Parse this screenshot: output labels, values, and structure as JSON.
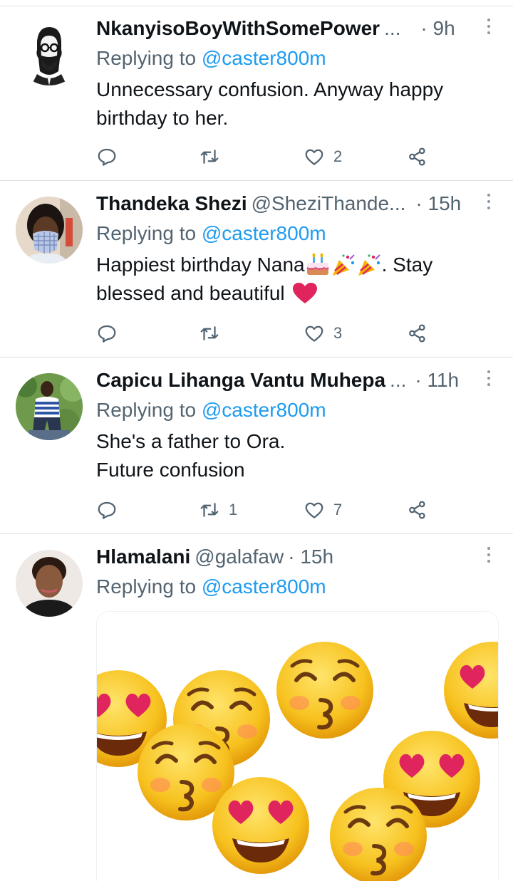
{
  "replies": [
    {
      "name": "NkanyisoBoyWithSomePower",
      "handle": "",
      "ellipsis": "...",
      "time": "· 9h",
      "replying_prefix": "Replying to ",
      "replying_handle": "@caster800m",
      "text_lines": [
        "Unnecessary confusion. Anyway happy",
        "birthday to her."
      ],
      "reply_count": "",
      "retweet_count": "",
      "like_count": "2"
    },
    {
      "name": "Thandeka Shezi",
      "handle": "@SheziThande...",
      "ellipsis": "",
      "time": "· 15h",
      "replying_prefix": "Replying to ",
      "replying_handle": "@caster800m",
      "text_line1": "Happiest birthday Nana",
      "text_line1_suffix": ". Stay",
      "text_line2": "blessed and beautiful",
      "reply_count": "",
      "retweet_count": "",
      "like_count": "3"
    },
    {
      "name": "Capicu Lihanga Vantu Muhepa",
      "handle": "",
      "ellipsis": "...",
      "time": "· 11h",
      "replying_prefix": "Replying to ",
      "replying_handle": "@caster800m",
      "text_lines": [
        "She's a father to Ora.",
        "Future confusion"
      ],
      "reply_count": "",
      "retweet_count": "1",
      "like_count": "7"
    },
    {
      "name": "Hlamalani",
      "handle": "@galafaw",
      "ellipsis": "",
      "time": "· 15h",
      "replying_prefix": "Replying to ",
      "replying_handle": "@caster800m",
      "media": "kissing and heart-eyes emoji image"
    }
  ],
  "icons": {
    "reply": "reply-icon",
    "retweet": "retweet-icon",
    "like": "heart-icon",
    "share": "share-icon",
    "more": "more-icon"
  },
  "colors": {
    "link": "#1d9bf0",
    "secondary_text": "#536471",
    "heart_emoji": "#e0245e",
    "emoji_yellow": "#f7b500"
  }
}
